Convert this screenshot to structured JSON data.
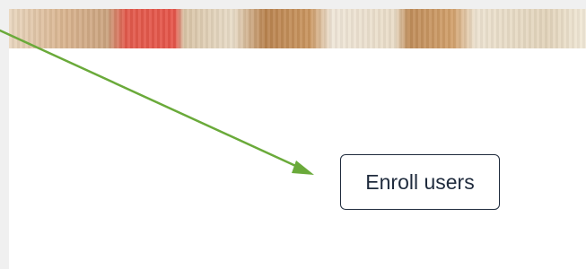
{
  "course": {
    "enroll_button_label": "Enroll users"
  },
  "annotation": {
    "arrow_color": "#6aaa3a"
  }
}
